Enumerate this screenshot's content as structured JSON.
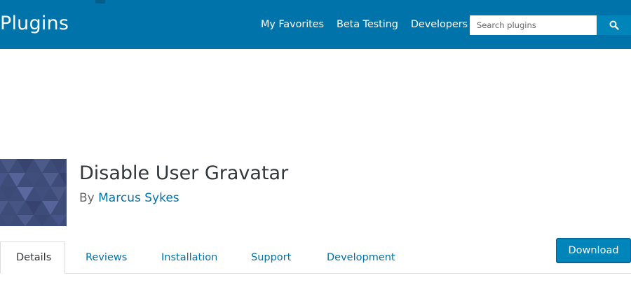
{
  "header": {
    "brand": "Plugins",
    "nav": [
      "My Favorites",
      "Beta Testing",
      "Developers"
    ],
    "search": {
      "placeholder": "Search plugins",
      "value": ""
    },
    "search_button_icon": "search-icon",
    "colors": {
      "bar": "#0073aa",
      "button": "#0085ba"
    }
  },
  "plugin": {
    "title": "Disable User Gravatar",
    "by_label": "By",
    "author": "Marcus Sykes",
    "icon": "plugin-banner-icon"
  },
  "tabs": {
    "items": [
      "Details",
      "Reviews",
      "Installation",
      "Support",
      "Development"
    ],
    "active": "Details"
  },
  "actions": {
    "download_label": "Download"
  }
}
